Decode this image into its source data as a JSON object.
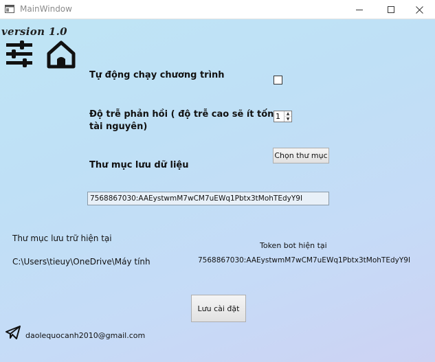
{
  "window": {
    "title": "MainWindow",
    "controls": [
      "minimize-icon",
      "maximize-icon",
      "close-icon"
    ]
  },
  "header": {
    "version": "version 1.0",
    "icons": [
      "settings-sliders-icon",
      "home-icon"
    ]
  },
  "settings": {
    "auto_run_label": "Tự động chạy chương trình",
    "auto_run_checked": false,
    "delay_label": "Độ trễ phản hồi ( độ trễ cao sẽ ít tốn tài nguyên)",
    "delay_value": "1",
    "folder_label": "Thư mục lưu dữ liệu",
    "choose_folder_button": "Chọn thư mục",
    "token_input_value": "7568867030:AAEystwmM7wCM7uEWq1Pbtx3tMohTEdyY9I"
  },
  "status": {
    "current_folder_label": "Thư mục lưu trữ hiện tại",
    "current_folder_path": "C:\\Users\\tieuy\\OneDrive\\Máy tính",
    "current_token_label": "Token bot hiện tại",
    "current_token_value": "7568867030:AAEystwmM7wCM7uEWq1Pbtx3tMohTEdyY9I"
  },
  "actions": {
    "save_button": "Lưu cài đặt"
  },
  "footer": {
    "icon": "telegram-icon",
    "email": "daolequocanh2010@gmail.com"
  }
}
